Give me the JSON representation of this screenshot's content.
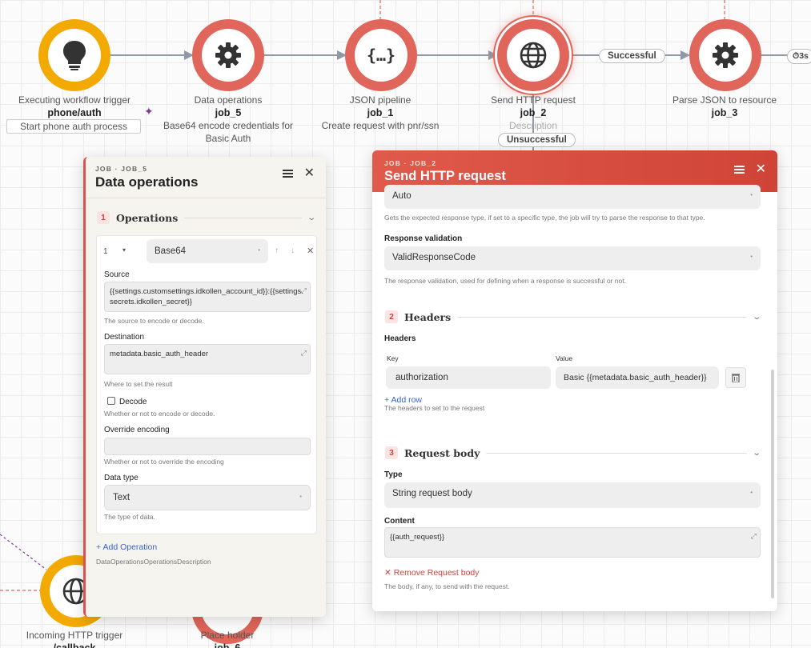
{
  "nodes": {
    "trigger": {
      "name": "Executing workflow trigger",
      "id": "phone/auth",
      "desc": "Start phone auth process"
    },
    "data_ops": {
      "name": "Data operations",
      "id": "job_5",
      "desc": "Base64 encode credentials for Basic Auth"
    },
    "json_pipe": {
      "name": "JSON pipeline",
      "id": "job_1",
      "desc": "Create request with pnr/ssn"
    },
    "http": {
      "name": "Send HTTP request",
      "id": "job_2",
      "desc": "Description"
    },
    "parse": {
      "name": "Parse JSON to resource",
      "id": "job_3"
    },
    "incoming": {
      "name": "Incoming HTTP trigger",
      "id": "/callback"
    },
    "placeholder": {
      "name": "Place holder",
      "id": "job_6"
    }
  },
  "edges": {
    "success": "Successful",
    "fail": "Unsuccessful",
    "timer": "3s"
  },
  "panel_data_ops": {
    "kicker": "JOB · JOB_5",
    "title": "Data operations",
    "section_num": "1",
    "section_title": "Operations",
    "op_index": "1",
    "op_caret": "▾",
    "op_type": "Base64",
    "up": "↑",
    "down": "↓",
    "remove": "✕",
    "source_label": "Source",
    "source_value": "{{settings.customsettings.idkollen_account_id}}:{{settings.secrets.idkollen_secret}}",
    "source_help": "The source to encode or decode.",
    "dest_label": "Destination",
    "dest_value": "metadata.basic_auth_header",
    "dest_help": "Where to set the result",
    "decode_label": "Decode",
    "decode_help": "Whether or not to encode or decode.",
    "override_label": "Override encoding",
    "override_value": "",
    "override_help": "Whether or not to override the encoding",
    "datatype_label": "Data type",
    "datatype_value": "Text",
    "datatype_help": "The type of data.",
    "add_op": "+ Add Operation",
    "footer_help": "DataOperationsOperationsDescription"
  },
  "panel_http": {
    "kicker": "JOB · JOB_2",
    "title": "Send HTTP request",
    "response_type_value": "Auto",
    "response_type_help": "Gets the expected response type, if set to a specific type, the job will try to parse the response to that type.",
    "validation_label": "Response validation",
    "validation_value": "ValidResponseCode",
    "validation_help": "The response validation, used for defining when a response is successful or not.",
    "headers_num": "2",
    "headers_title": "Headers",
    "headers_label": "Headers",
    "key_col": "Key",
    "value_col": "Value",
    "header_key": "authorization",
    "header_value": "Basic {{metadata.basic_auth_header}}",
    "add_row": "+ Add row",
    "headers_help": "The headers to set to the request",
    "body_num": "3",
    "body_title": "Request body",
    "type_label": "Type",
    "type_value": "String request body",
    "content_label": "Content",
    "content_value": "{{auth_request}}",
    "remove_body": "✕ Remove Request body",
    "body_help": "The body, if any, to send with the request."
  }
}
